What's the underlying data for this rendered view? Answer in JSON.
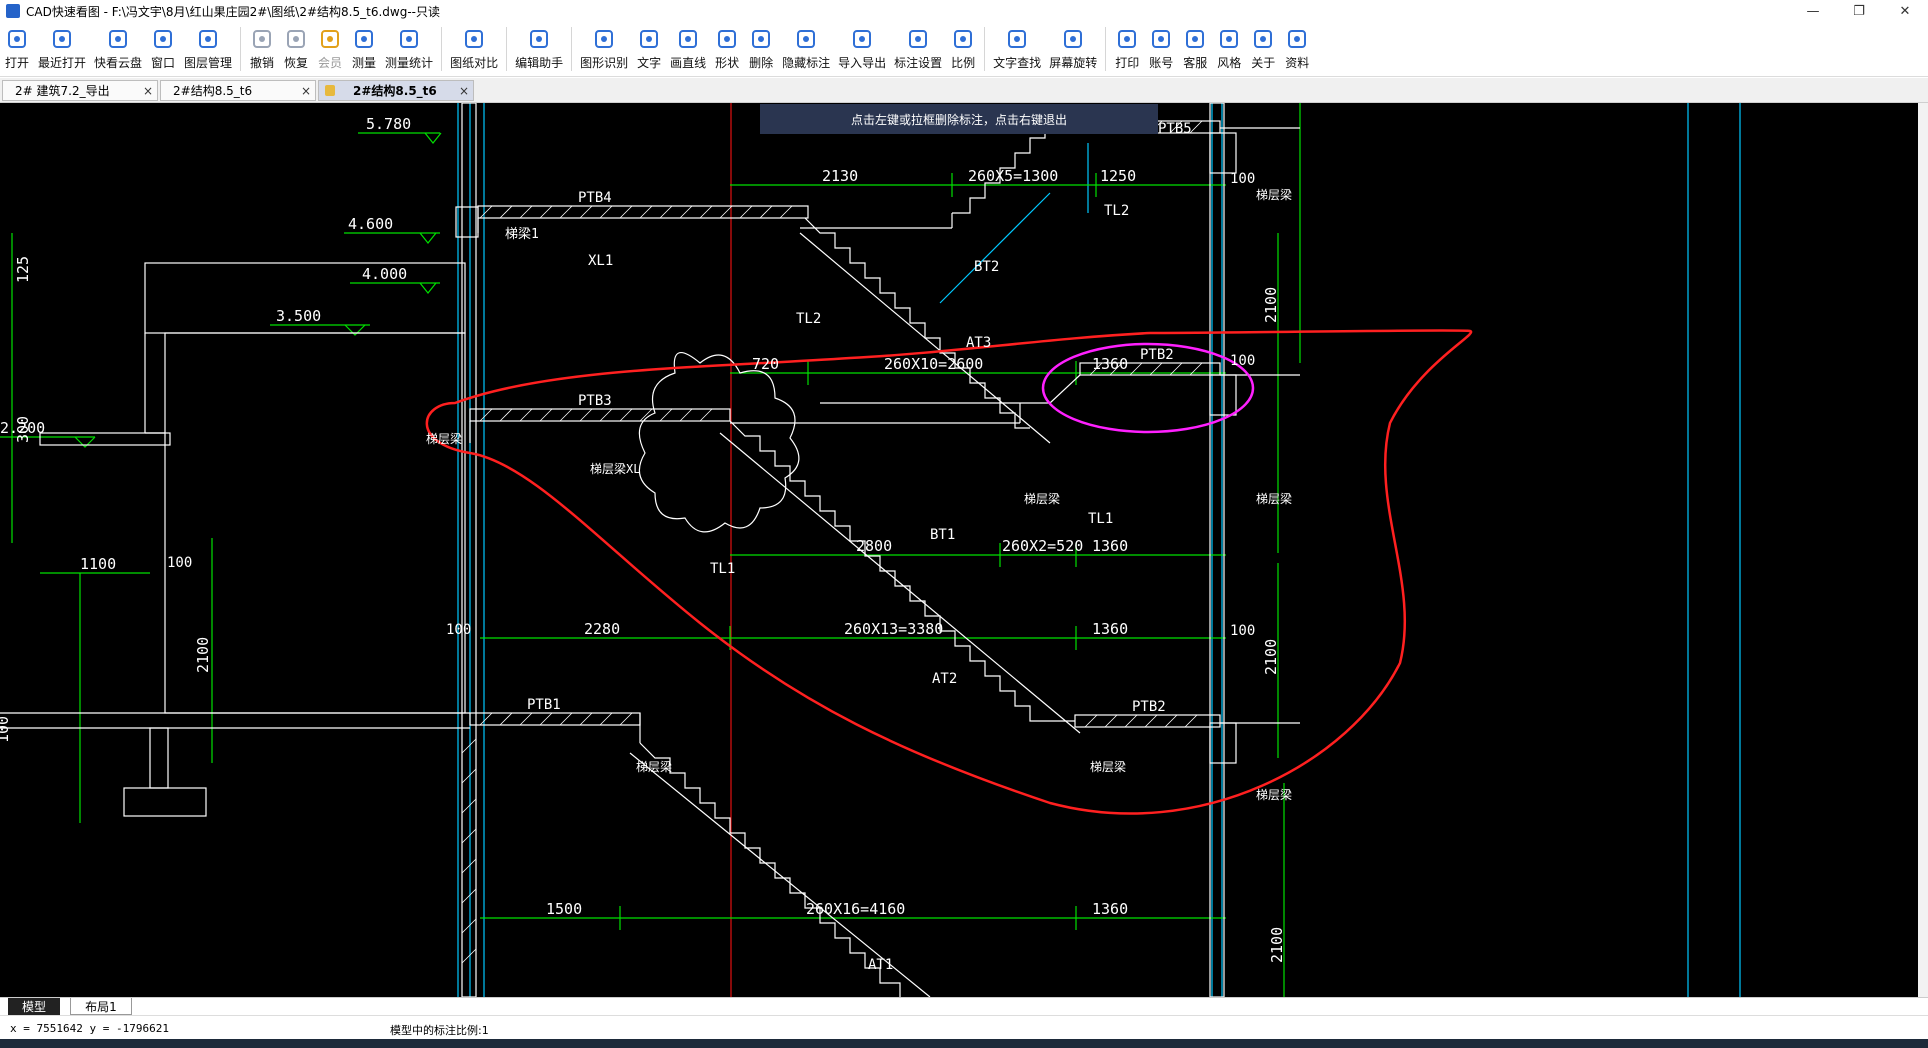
{
  "window": {
    "title": "CAD快速看图 - F:\\冯文宇\\8月\\红山果庄园2#\\图纸\\2#结构8.5_t6.dwg--只读"
  },
  "toolbar": {
    "items": [
      {
        "label": "打开",
        "icon": "folder-open-icon"
      },
      {
        "label": "最近打开",
        "icon": "recent-clock-icon"
      },
      {
        "label": "快看云盘",
        "icon": "cloud-icon"
      },
      {
        "label": "窗口",
        "icon": "window-icon"
      },
      {
        "label": "图层管理",
        "icon": "layers-icon"
      },
      {
        "label": "撤销",
        "icon": "undo-icon"
      },
      {
        "label": "恢复",
        "icon": "redo-icon"
      },
      {
        "label": "会员",
        "icon": "vip-icon"
      },
      {
        "label": "测量",
        "icon": "ruler-icon"
      },
      {
        "label": "测量统计",
        "icon": "measure-stats-icon"
      },
      {
        "label": "图纸对比",
        "icon": "compare-icon"
      },
      {
        "label": "编辑助手",
        "icon": "edit-assistant-icon"
      },
      {
        "label": "图形识别",
        "icon": "shape-recognition-icon"
      },
      {
        "label": "文字",
        "icon": "text-icon"
      },
      {
        "label": "画直线",
        "icon": "line-icon"
      },
      {
        "label": "形状",
        "icon": "shape-icon"
      },
      {
        "label": "删除",
        "icon": "eraser-icon"
      },
      {
        "label": "隐藏标注",
        "icon": "eye-hide-icon"
      },
      {
        "label": "导入导出",
        "icon": "import-export-icon"
      },
      {
        "label": "标注设置",
        "icon": "annotation-settings-icon"
      },
      {
        "label": "比例",
        "icon": "scale-icon"
      },
      {
        "label": "文字查找",
        "icon": "text-search-icon"
      },
      {
        "label": "屏幕旋转",
        "icon": "rotate-screen-icon"
      },
      {
        "label": "打印",
        "icon": "printer-icon"
      },
      {
        "label": "账号",
        "icon": "account-icon"
      },
      {
        "label": "客服",
        "icon": "headset-icon"
      },
      {
        "label": "风格",
        "icon": "style-icon"
      },
      {
        "label": "关于",
        "icon": "info-icon"
      },
      {
        "label": "资料",
        "icon": "documents-icon"
      }
    ]
  },
  "tabs": [
    {
      "label": "2# 建筑7.2_导出",
      "close": "×"
    },
    {
      "label": "2#结构8.5_t6",
      "close": "×"
    },
    {
      "label": "2#结构8.5_t6",
      "close": "×"
    }
  ],
  "tooltip": {
    "text": "点击左键或拉框删除标注，点击右键退出"
  },
  "drawing": {
    "elevations": [
      "5.780",
      "4.600",
      "4.000",
      "3.500",
      "2.200"
    ],
    "dims": [
      "2130",
      "260X5=1300",
      "1250",
      "720",
      "260X10=2600",
      "1360",
      "2800",
      "260X2=520",
      "1360",
      "2280",
      "260X13=3380",
      "1360",
      "1500",
      "260X16=4160",
      "1360",
      "1100"
    ],
    "dims_small": [
      "100",
      "100",
      "100",
      "100",
      "100"
    ],
    "dims_vertical": [
      "2100",
      "2100",
      "2100",
      "2100",
      "125",
      "300",
      "100"
    ],
    "labels": [
      "PTB5",
      "PTB4",
      "PTB3",
      "PTB2",
      "PTB2",
      "PTB1",
      "TL2",
      "TL2",
      "TL1",
      "TL1",
      "BT2",
      "BT1",
      "AT3",
      "AT2",
      "AT1",
      "XL1",
      "梯梁1",
      "梯层梁",
      "梯层梁",
      "梯层梁",
      "梯层梁",
      "梯层梁",
      "梯层梁",
      "梯层梁",
      "梯层梁XL"
    ],
    "colors": {
      "background": "#000000",
      "lines": "#ffffff",
      "dims": "#00ff00",
      "grid": "#00c8ff",
      "axis": "#e01010",
      "markup_red": "#ff2020",
      "markup_magenta": "#ff20ff"
    }
  },
  "layout_tabs": [
    "模型",
    "布局1"
  ],
  "status": {
    "coords": "x = 7551642  y = -1796621",
    "scale": "模型中的标注比例:1"
  }
}
